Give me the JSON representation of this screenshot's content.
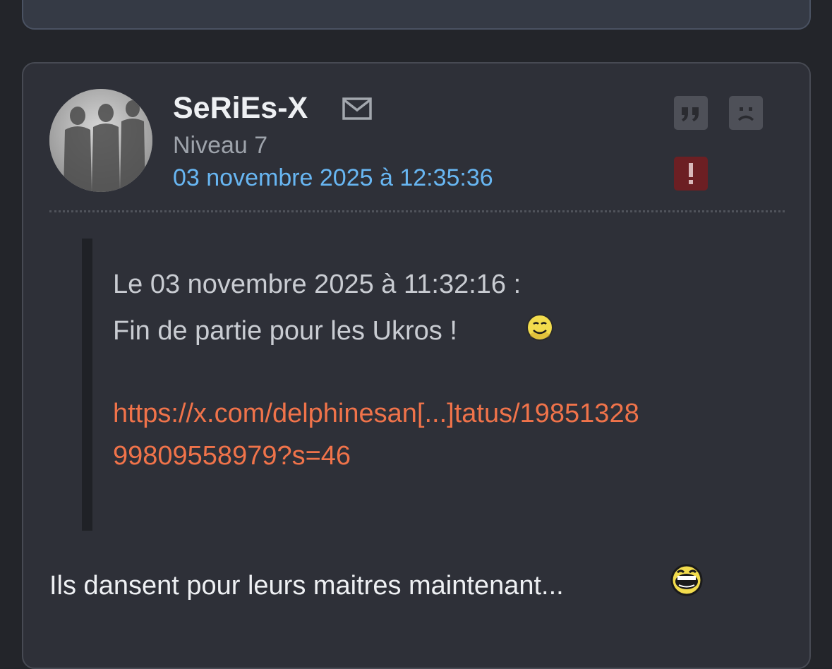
{
  "post": {
    "username": "SeRiEs-X",
    "level": "Niveau 7",
    "date": "03 novembre 2025 à 12:35:36",
    "quote": {
      "header": "Le 03 novembre 2025 à 11:32:16 :",
      "text": "Fin de partie pour les Ukros !",
      "link_line1": "https://x.com/delphinesan[...]tatus/19851328",
      "link_line2": "99809558979?s=46"
    },
    "body": "Ils dansent pour leurs maitres maintenant..."
  },
  "icons": {
    "mail": "mail-icon",
    "quote": "quote-icon",
    "sad": "sad-face-icon",
    "report": "exclamation-icon"
  },
  "colors": {
    "background": "#23252a",
    "card": "#2e3038",
    "date": "#68b6f2",
    "link": "#f0734a",
    "report": "#6c1f23"
  }
}
